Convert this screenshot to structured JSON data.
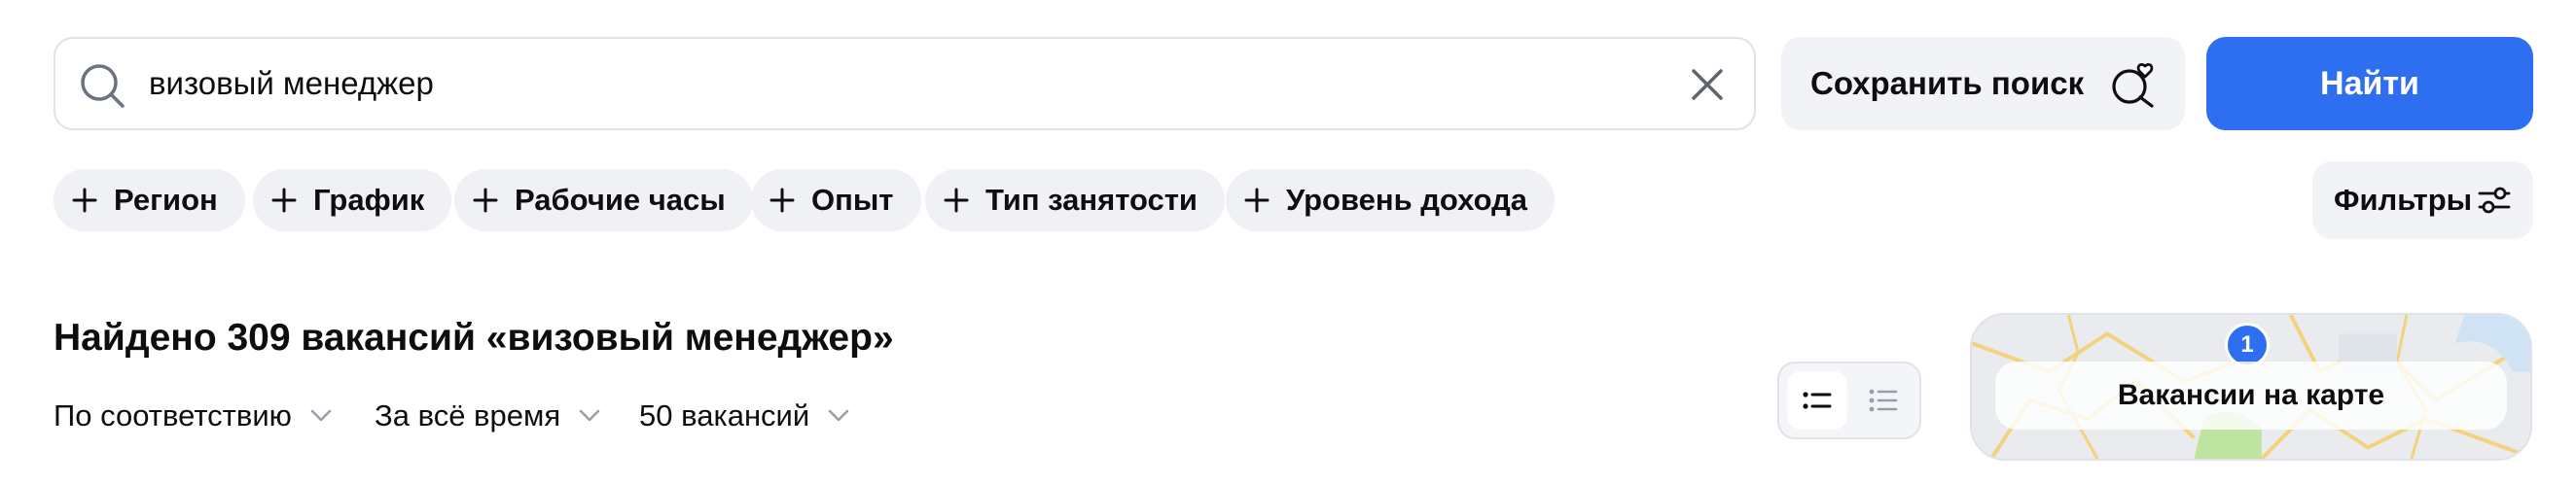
{
  "search": {
    "value": "визовый менеджер",
    "save_label": "Сохранить поиск",
    "find_label": "Найти"
  },
  "chips": [
    {
      "label": "Регион"
    },
    {
      "label": "График"
    },
    {
      "label": "Рабочие часы"
    },
    {
      "label": "Опыт"
    },
    {
      "label": "Тип занятости"
    },
    {
      "label": "Уровень дохода"
    }
  ],
  "filters": {
    "label": "Фильтры"
  },
  "results": {
    "title": "Найдено 309 вакансий «визовый менеджер»",
    "sort_relevance": "По соответствию",
    "sort_period": "За всё время",
    "sort_count": "50 вакансий"
  },
  "map": {
    "label": "Вакансии на карте",
    "pin_count": "1"
  },
  "colors": {
    "accent": "#2e6ff2",
    "chip_bg": "#eff1f5",
    "border": "#dfe2e8"
  }
}
